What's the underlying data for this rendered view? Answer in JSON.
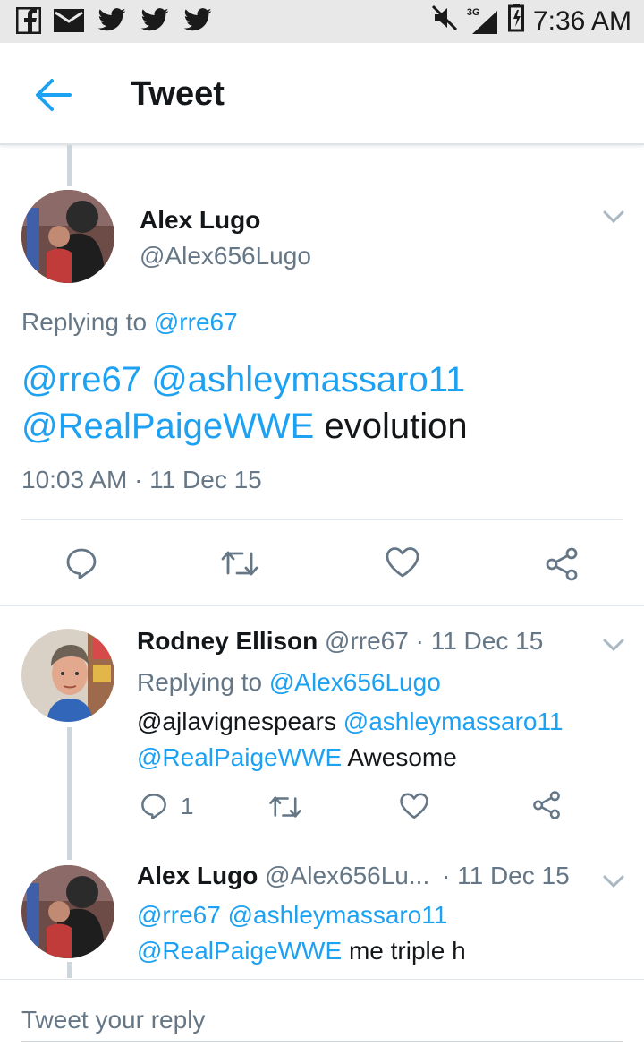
{
  "status_bar": {
    "time": "7:36 AM",
    "network": "3G",
    "icons_left": [
      "facebook-icon",
      "mail-icon",
      "twitter-icon",
      "twitter-icon",
      "twitter-icon"
    ],
    "icons_right": [
      "mute-icon",
      "signal-icon",
      "battery-icon"
    ]
  },
  "header": {
    "title": "Tweet"
  },
  "main_tweet": {
    "name": "Alex Lugo",
    "handle": "@Alex656Lugo",
    "replying_prefix": "Replying to",
    "replying_to": "@rre67",
    "mention1": "@rre67",
    "mention2": "@ashleymassaro11",
    "mention3": "@RealPaigeWWE",
    "text": "evolution",
    "timestamp": "10:03 AM · 11 Dec 15"
  },
  "reply1": {
    "name": "Rodney Ellison",
    "handle": "@rre67",
    "date": "· 11 Dec 15",
    "replying_prefix": "Replying to",
    "replying_to": "@Alex656Lugo",
    "text1": "@ajlavignespears",
    "mention1": "@ashleymassaro11",
    "mention2": "@RealPaigeWWE",
    "text2": "Awesome",
    "reply_count": "1"
  },
  "reply2": {
    "name": "Alex Lugo",
    "handle": "@Alex656Lu...",
    "date": "· 11 Dec 15",
    "mention1": "@rre67",
    "mention2": "@ashleymassaro11",
    "mention3": "@RealPaigeWWE",
    "text": "me triple h"
  },
  "compose": {
    "placeholder": "Tweet your reply"
  },
  "colors": {
    "link": "#1da1f2",
    "secondary": "#657786",
    "text": "#14171a"
  }
}
